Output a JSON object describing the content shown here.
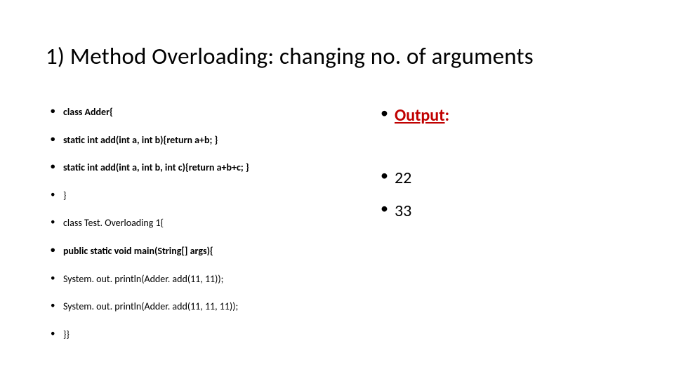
{
  "title": "1) Method Overloading: changing no. of arguments",
  "code": {
    "l0": "class Adder{",
    "l1": "static int add(int a, int b){return a+b; }",
    "l2": "static int add(int a, int b, int c){return a+b+c; }",
    "l3": "}",
    "l4": "class Test. Overloading 1{",
    "l5": "public static void main(String[] args){",
    "l6": "System. out. println(Adder. add(11, 11));",
    "l7": "System. out. println(Adder. add(11, 11, 11));",
    "l8": "}}"
  },
  "output": {
    "heading_text": "Output",
    "heading_colon": ":",
    "v0": "22",
    "v1": "33"
  }
}
